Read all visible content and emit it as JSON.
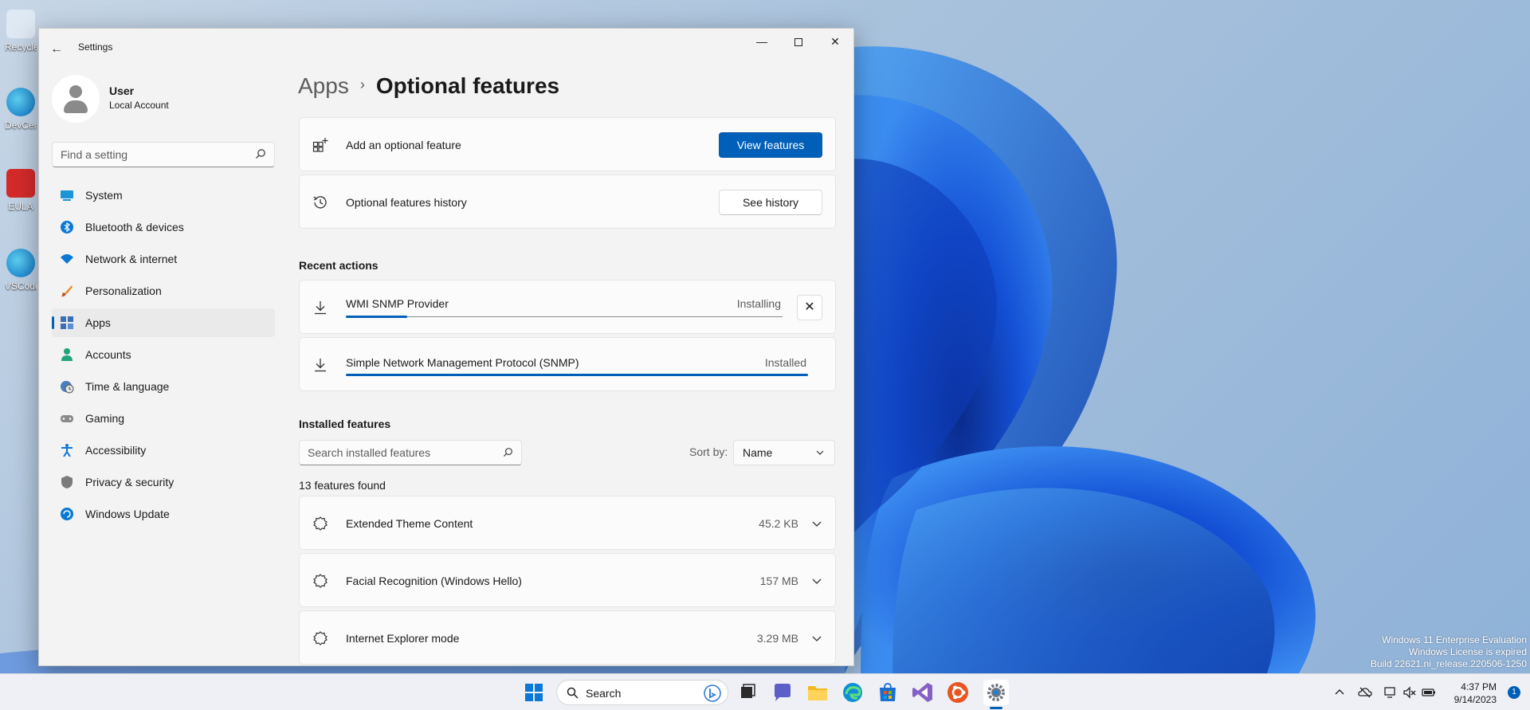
{
  "desktop": {
    "icons": [
      {
        "label": "Recycle Bin",
        "icon": "recycle-bin-icon"
      },
      {
        "label": "DevCenter",
        "icon": "edge-dev-icon"
      },
      {
        "label": "EULA",
        "icon": "pdf-icon"
      },
      {
        "label": "VSCode",
        "icon": "edge-icon"
      }
    ],
    "watermark": [
      "Windows 11 Enterprise Evaluation",
      "Windows License is expired",
      "Build 22621.ni_release.220506-1250"
    ]
  },
  "window": {
    "title": "Settings",
    "back_icon": "back-arrow-icon",
    "controls": [
      "minimize",
      "maximize",
      "close"
    ]
  },
  "profile": {
    "name": "User",
    "account_type": "Local Account"
  },
  "search": {
    "placeholder": "Find a setting"
  },
  "nav": {
    "items": [
      {
        "label": "System",
        "icon": "system-icon",
        "active": false
      },
      {
        "label": "Bluetooth & devices",
        "icon": "bluetooth-icon",
        "active": false
      },
      {
        "label": "Network & internet",
        "icon": "wifi-icon",
        "active": false
      },
      {
        "label": "Personalization",
        "icon": "brush-icon",
        "active": false
      },
      {
        "label": "Apps",
        "icon": "apps-icon",
        "active": true
      },
      {
        "label": "Accounts",
        "icon": "accounts-icon",
        "active": false
      },
      {
        "label": "Time & language",
        "icon": "globe-clock-icon",
        "active": false
      },
      {
        "label": "Gaming",
        "icon": "gamepad-icon",
        "active": false
      },
      {
        "label": "Accessibility",
        "icon": "accessibility-icon",
        "active": false
      },
      {
        "label": "Privacy & security",
        "icon": "shield-icon",
        "active": false
      },
      {
        "label": "Windows Update",
        "icon": "update-icon",
        "active": false
      }
    ]
  },
  "breadcrumb": {
    "parent": "Apps",
    "separator": "›",
    "current": "Optional features"
  },
  "add_feature": {
    "label": "Add an optional feature",
    "button": "View features"
  },
  "history": {
    "label": "Optional features history",
    "button": "See history"
  },
  "recent_actions": {
    "title": "Recent actions",
    "items": [
      {
        "name": "WMI SNMP Provider",
        "status": "Installing",
        "progress": 0.14,
        "cancel": "✕"
      },
      {
        "name": "Simple Network Management Protocol (SNMP)",
        "status": "Installed",
        "progress": 1.0
      }
    ]
  },
  "installed": {
    "title": "Installed features",
    "search_placeholder": "Search installed features",
    "sort_label": "Sort by:",
    "sort_value": "Name",
    "count_text": "13 features found",
    "items": [
      {
        "name": "Extended Theme Content",
        "size": "45.2 KB"
      },
      {
        "name": "Facial Recognition (Windows Hello)",
        "size": "157 MB"
      },
      {
        "name": "Internet Explorer mode",
        "size": "3.29 MB"
      }
    ]
  },
  "taskbar": {
    "search_text": "Search",
    "apps": [
      "start-icon",
      "task-view-icon",
      "teams-chat-icon",
      "file-explorer-icon",
      "edge-icon",
      "store-icon",
      "visual-studio-icon",
      "ubuntu-icon",
      "settings-icon"
    ],
    "time": "4:37 PM",
    "date": "9/14/2023",
    "notification_count": "1"
  },
  "colors": {
    "accent": "#005fb8",
    "window_bg": "#f3f3f3",
    "card_bg": "#fbfbfb"
  }
}
